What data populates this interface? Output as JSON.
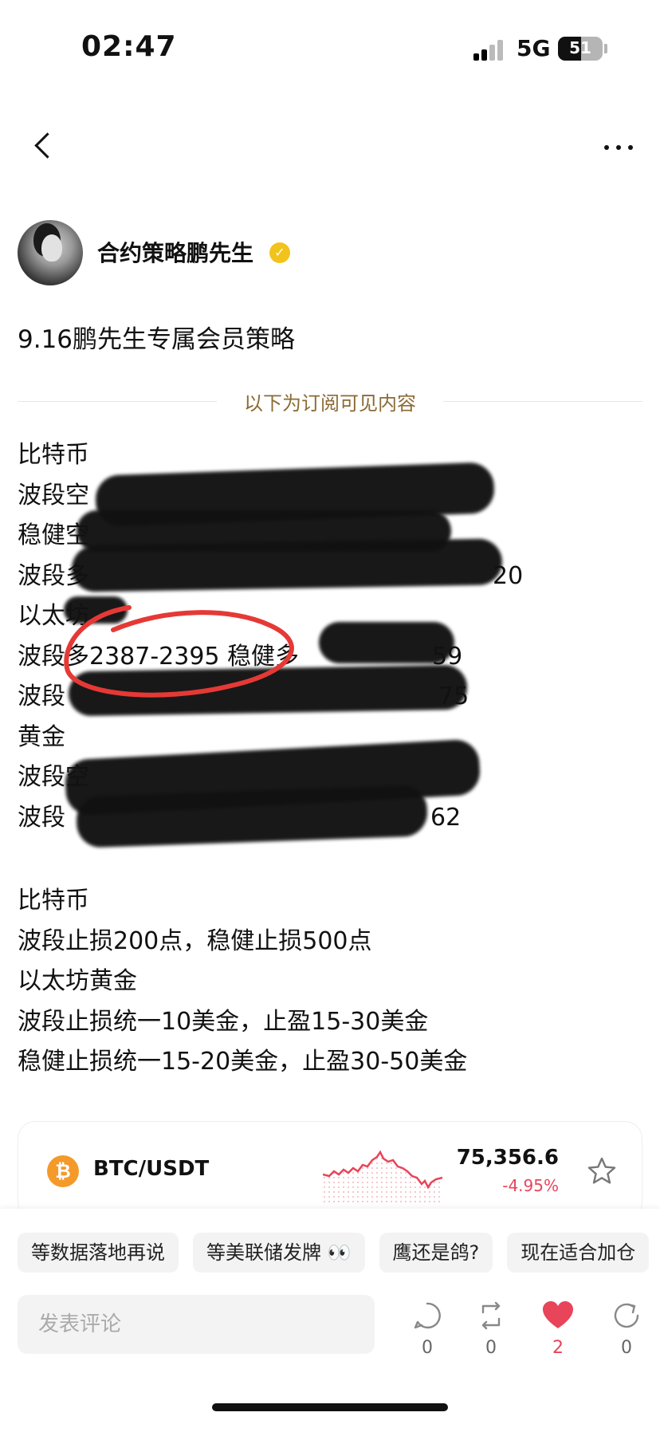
{
  "status_bar": {
    "time": "02:47",
    "network": "5G",
    "battery": "51",
    "battery_level": 0.51
  },
  "post": {
    "author": "合约策略鹏先生",
    "title": "9.16鹏先生专属会员策略",
    "subscription_divider": "以下为订阅可见内容",
    "lines_top": [
      "比特币",
      "波段空",
      "稳健空",
      "波段多",
      "以太坊",
      "波段多2387-2395 稳健多",
      "波段",
      "黄金",
      "波段空",
      "波段"
    ],
    "partial_tails": {
      "line4": "20",
      "line6": "59",
      "line7": "75",
      "line10": "62"
    },
    "lines_bottom": [
      "比特币",
      "波段止损200点，稳健止损500点",
      "以太坊黄金",
      "波段止损统一10美金，止盈15-30美金",
      "稳健止损统一15-20美金，止盈30-50美金"
    ]
  },
  "ticker": {
    "symbol_icon": "bitcoin-icon",
    "pair": "BTC/USDT",
    "price": "75,356.6",
    "change": "-4.95%",
    "sparkline_color": "#e8445a"
  },
  "topic_chips": [
    "等数据落地再说",
    "等美联储发牌 👀",
    "鹰还是鸽?",
    "现在适合加仓"
  ],
  "comment": {
    "placeholder": "发表评论"
  },
  "actions": [
    {
      "icon": "comment-icon",
      "count": "0"
    },
    {
      "icon": "repost-icon",
      "count": "0"
    },
    {
      "icon": "heart-icon",
      "count": "2",
      "active": true
    },
    {
      "icon": "share-icon",
      "count": "0"
    }
  ],
  "colors": {
    "accent_red": "#e8445a",
    "divider_gold": "#8b6a35",
    "verified_gold": "#f2c31b",
    "bitcoin_orange": "#f39a2a"
  }
}
